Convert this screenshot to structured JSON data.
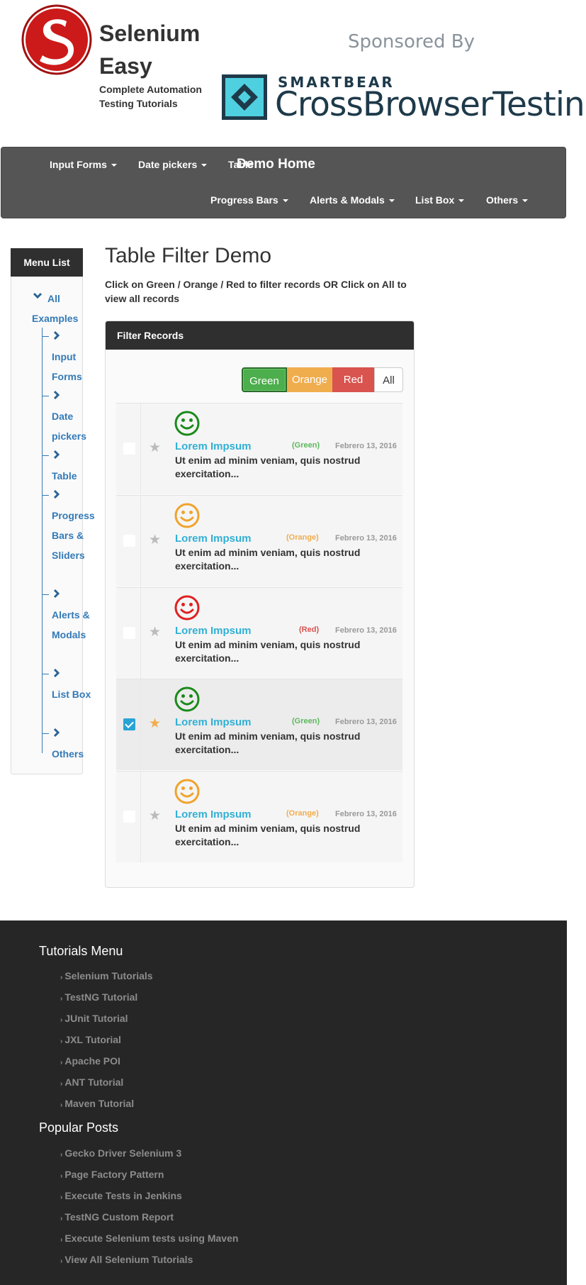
{
  "brand": {
    "title": "Selenium Easy",
    "subtitle": "Complete Automation Testing Tutorials"
  },
  "sponsor": {
    "label": "Sponsored By",
    "smartbear": "SMARTBEAR",
    "cbt": "CrossBrowserTesting"
  },
  "nav": {
    "demo_home": "Demo Home",
    "items": [
      {
        "label": "Input Forms"
      },
      {
        "label": "Date pickers"
      },
      {
        "label": "Table"
      },
      {
        "label": "Progress Bars"
      },
      {
        "label": "Alerts & Modals"
      },
      {
        "label": "List Box"
      },
      {
        "label": "Others"
      }
    ]
  },
  "sidebar": {
    "header": "Menu List",
    "all": "All Examples",
    "items": [
      {
        "label": "Input Forms"
      },
      {
        "label": "Date pickers"
      },
      {
        "label": "Table"
      },
      {
        "label": "Progress Bars & Sliders"
      },
      {
        "label": "Alerts & Modals"
      },
      {
        "label": "List Box"
      },
      {
        "label": "Others"
      }
    ]
  },
  "main": {
    "title": "Table Filter Demo",
    "description": "Click on Green / Orange / Red to filter records OR Click on All to view all records",
    "panel_title": "Filter Records",
    "filters": {
      "green": "Green",
      "orange": "Orange",
      "red": "Red",
      "all": "All"
    },
    "records": [
      {
        "title": "Lorem Impsum",
        "tag": "(Green)",
        "color": "#1a8a1a",
        "tag_color": "#5cb85c",
        "date": "Febrero 13, 2016",
        "body": "Ut enim ad minim veniam, quis nostrud exercitation...",
        "checked": false,
        "starred": false
      },
      {
        "title": "Lorem Impsum",
        "tag": "(Orange)",
        "color": "#f0a32b",
        "tag_color": "#f0ad4e",
        "date": "Febrero 13, 2016",
        "body": "Ut enim ad minim veniam, quis nostrud exercitation...",
        "checked": false,
        "starred": false
      },
      {
        "title": "Lorem Impsum",
        "tag": "(Red)",
        "color": "#e02020",
        "tag_color": "#d9534f",
        "date": "Febrero 13, 2016",
        "body": "Ut enim ad minim veniam, quis nostrud exercitation...",
        "checked": false,
        "starred": false
      },
      {
        "title": "Lorem Impsum",
        "tag": "(Green)",
        "color": "#1a8a1a",
        "tag_color": "#5cb85c",
        "date": "Febrero 13, 2016",
        "body": "Ut enim ad minim veniam, quis nostrud exercitation...",
        "checked": true,
        "starred": true
      },
      {
        "title": "Lorem Impsum",
        "tag": "(Orange)",
        "color": "#f0a32b",
        "tag_color": "#f0ad4e",
        "date": "Febrero 13, 2016",
        "body": "Ut enim ad minim veniam, quis nostrud exercitation...",
        "checked": false,
        "starred": false
      }
    ]
  },
  "footer": {
    "tutorials_heading": "Tutorials Menu",
    "tutorials": [
      "Selenium Tutorials",
      "TestNG Tutorial",
      "JUnit Tutorial",
      "JXL Tutorial",
      "Apache POI",
      "ANT Tutorial",
      "Maven Tutorial"
    ],
    "posts_heading": "Popular Posts",
    "posts": [
      "Gecko Driver Selenium 3",
      "Page Factory Pattern",
      "Execute Tests in Jenkins",
      "TestNG Custom Report",
      "Execute Selenium tests using Maven",
      "View All Selenium Tutorials"
    ]
  }
}
